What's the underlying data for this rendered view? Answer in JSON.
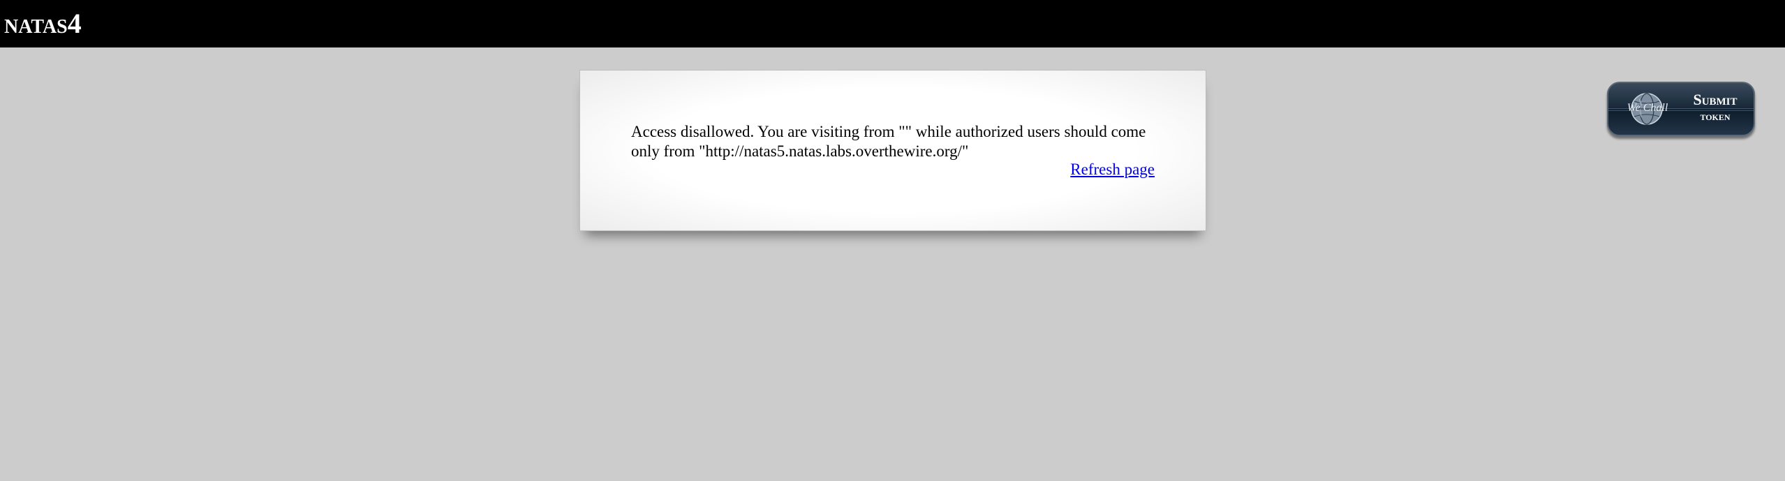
{
  "header": {
    "title": "natas4"
  },
  "content": {
    "message": "Access disallowed. You are visiting from \"\" while authorized users should come only from \"http://natas5.natas.labs.overthewire.org/\"",
    "refresh_link": "Refresh page"
  },
  "wechall": {
    "logo_text": "We Chall",
    "submit_label": "Submit",
    "token_label": "token",
    "icon": "globe-icon"
  },
  "colors": {
    "background": "#cccccc",
    "header_background": "#000000",
    "link": "#0000ee"
  }
}
